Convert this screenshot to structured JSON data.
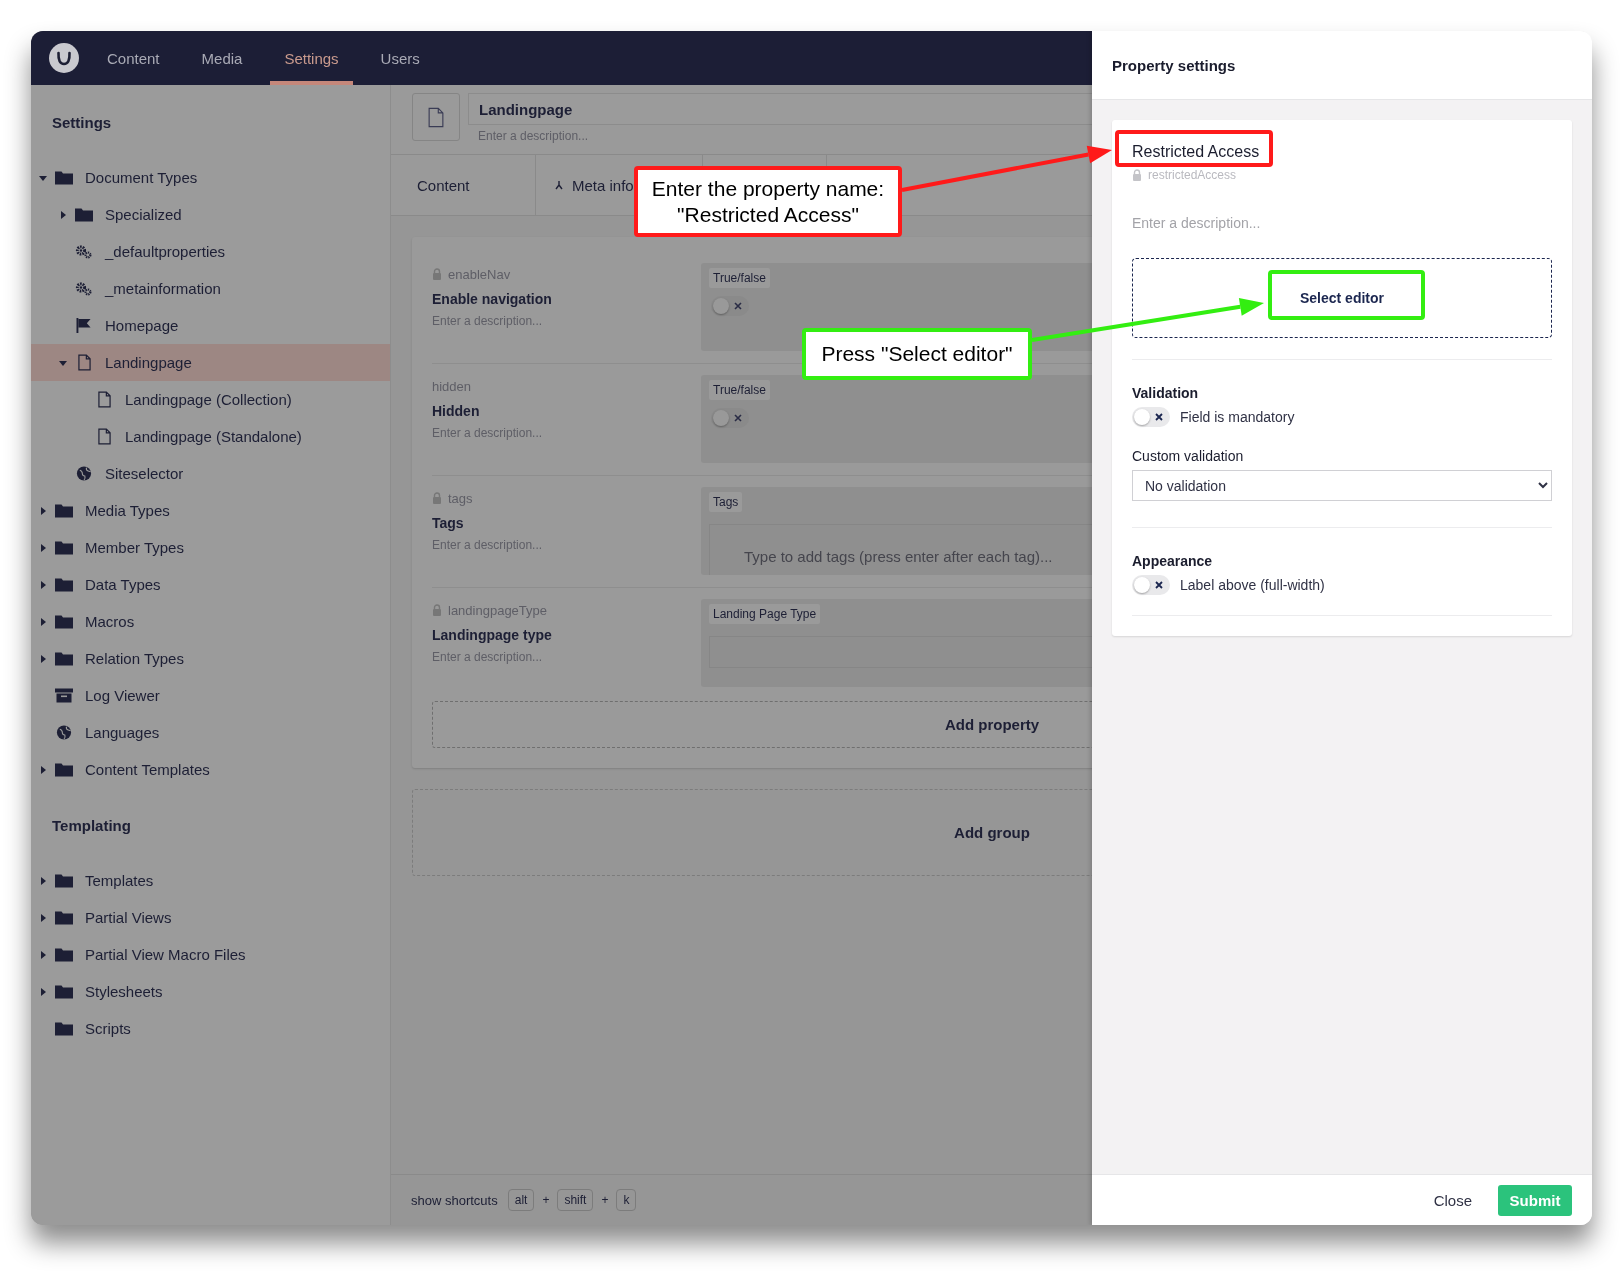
{
  "topnav": {
    "sections": [
      {
        "label": "Content",
        "selected": false
      },
      {
        "label": "Media",
        "selected": false
      },
      {
        "label": "Settings",
        "selected": true
      },
      {
        "label": "Users",
        "selected": false
      }
    ]
  },
  "sidebar": {
    "groups": [
      {
        "title": "Settings",
        "items": [
          {
            "label": "Document Types",
            "kind": "folder",
            "expanded": true,
            "selected": false,
            "children": [
              {
                "label": "Specialized",
                "kind": "folder",
                "expanded": false,
                "selected": false
              },
              {
                "label": "_defaultproperties",
                "kind": "gears",
                "selected": false
              },
              {
                "label": "_metainformation",
                "kind": "gears",
                "selected": false
              },
              {
                "label": "Homepage",
                "kind": "flag",
                "selected": false
              },
              {
                "label": "Landingpage",
                "kind": "document",
                "expanded": true,
                "selected": true,
                "children": [
                  {
                    "label": "Landingpage (Collection)",
                    "kind": "document",
                    "selected": false
                  },
                  {
                    "label": "Landingpage (Standalone)",
                    "kind": "document",
                    "selected": false
                  }
                ]
              },
              {
                "label": "Siteselector",
                "kind": "globe",
                "selected": false
              }
            ]
          },
          {
            "label": "Media Types",
            "kind": "folder",
            "expanded": false,
            "selected": false
          },
          {
            "label": "Member Types",
            "kind": "folder",
            "expanded": false,
            "selected": false
          },
          {
            "label": "Data Types",
            "kind": "folder",
            "expanded": false,
            "selected": false
          },
          {
            "label": "Macros",
            "kind": "folder",
            "expanded": false,
            "selected": false
          },
          {
            "label": "Relation Types",
            "kind": "folder",
            "expanded": false,
            "selected": false
          },
          {
            "label": "Log Viewer",
            "kind": "archive",
            "selected": false
          },
          {
            "label": "Languages",
            "kind": "globe",
            "selected": false
          },
          {
            "label": "Content Templates",
            "kind": "folder",
            "expanded": false,
            "selected": false
          }
        ]
      },
      {
        "title": "Templating",
        "items": [
          {
            "label": "Templates",
            "kind": "folder",
            "expanded": false,
            "selected": false
          },
          {
            "label": "Partial Views",
            "kind": "folder",
            "expanded": false,
            "selected": false
          },
          {
            "label": "Partial View Macro Files",
            "kind": "folder",
            "expanded": false,
            "selected": false
          },
          {
            "label": "Stylesheets",
            "kind": "folder",
            "expanded": false,
            "selected": false
          },
          {
            "label": "Scripts",
            "kind": "folder",
            "selected": false
          }
        ]
      }
    ]
  },
  "document_type": {
    "name": "Landingpage",
    "description_placeholder": "Enter a description...",
    "tabs": [
      {
        "label": "Content"
      },
      {
        "label": "Meta info"
      }
    ],
    "properties": [
      {
        "alias": "enableNav",
        "locked": true,
        "name": "Enable navigation",
        "description_placeholder": "Enter a description...",
        "editor": {
          "label": "True/false",
          "kind": "toggle",
          "on": false
        }
      },
      {
        "alias": "hidden",
        "locked": false,
        "name": "Hidden",
        "description_placeholder": "Enter a description...",
        "editor": {
          "label": "True/false",
          "kind": "toggle",
          "on": false
        }
      },
      {
        "alias": "tags",
        "locked": true,
        "name": "Tags",
        "description_placeholder": "Enter a description...",
        "editor": {
          "label": "Tags",
          "kind": "tags",
          "placeholder": "Type to add tags (press enter after each tag)..."
        }
      },
      {
        "alias": "landingpageType",
        "locked": true,
        "name": "Landingpage type",
        "description_placeholder": "Enter a description...",
        "editor": {
          "label": "Landing Page Type",
          "kind": "text"
        }
      }
    ],
    "add_property": "Add property",
    "add_group": "Add group"
  },
  "shortcuts": {
    "label": "show shortcuts",
    "parts": [
      {
        "kind": "key",
        "text": "alt"
      },
      {
        "kind": "plus",
        "text": "+"
      },
      {
        "kind": "key",
        "text": "shift"
      },
      {
        "kind": "plus",
        "text": "+"
      },
      {
        "kind": "key",
        "text": "k"
      }
    ]
  },
  "panel": {
    "title": "Property settings",
    "property_name": "Restricted Access",
    "alias": "restrictedAccess",
    "alias_locked": true,
    "description_placeholder": "Enter a description...",
    "select_editor": "Select editor",
    "validation": {
      "heading": "Validation",
      "mandatory": {
        "label": "Field is mandatory",
        "on": false
      },
      "custom_label": "Custom validation",
      "custom_value": "No validation"
    },
    "appearance": {
      "heading": "Appearance",
      "label_above": {
        "label": "Label above (full-width)",
        "on": false
      }
    },
    "close": "Close",
    "submit": "Submit"
  },
  "annotations": [
    {
      "kind": "name-callout",
      "text": "Enter the property name:\n\"Restricted Access\"",
      "color": "#ff1a1a"
    },
    {
      "kind": "editor-callout",
      "text": "Press \"Select editor\"",
      "color": "#33ee11"
    }
  ]
}
